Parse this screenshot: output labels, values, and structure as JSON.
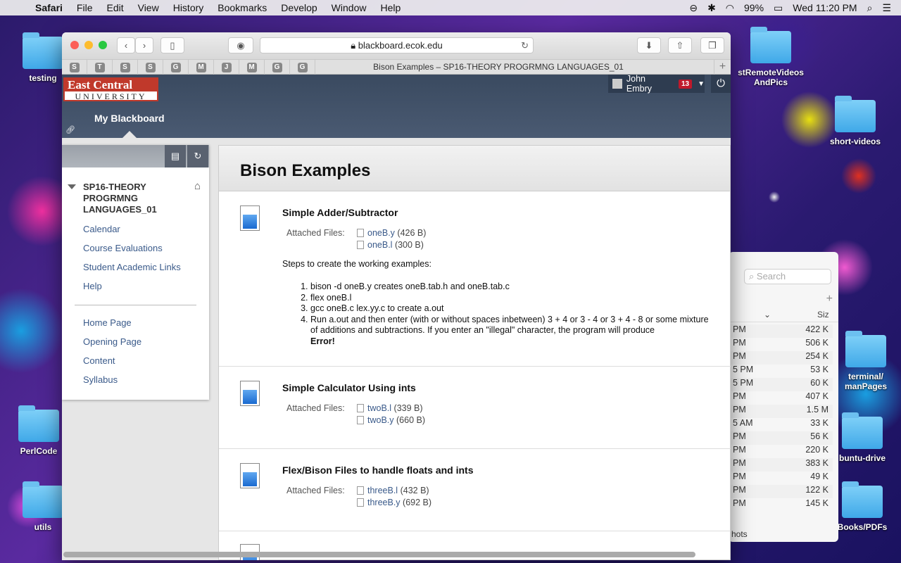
{
  "menubar": {
    "items": [
      "Safari",
      "File",
      "Edit",
      "View",
      "History",
      "Bookmarks",
      "Develop",
      "Window",
      "Help"
    ],
    "battery": "99%",
    "clock": "Wed 11:20 PM"
  },
  "desktop": {
    "icons": [
      "testing",
      "stRemoteVideos AndPics",
      "short-videos",
      "PerlCode",
      "utils",
      "terminal/ manPages",
      "buntu-drive",
      "Books/PDFs"
    ]
  },
  "finder": {
    "search_placeholder": "Search",
    "size_header": "Siz",
    "rows": [
      {
        "date": "PM",
        "size": "422 K"
      },
      {
        "date": "PM",
        "size": "506 K"
      },
      {
        "date": "PM",
        "size": "254 K"
      },
      {
        "date": "5 PM",
        "size": "53 K"
      },
      {
        "date": "5 PM",
        "size": "60 K"
      },
      {
        "date": "PM",
        "size": "407 K"
      },
      {
        "date": "PM",
        "size": "1.5 M"
      },
      {
        "date": "5 AM",
        "size": "33 K"
      },
      {
        "date": "PM",
        "size": "56 K"
      },
      {
        "date": "PM",
        "size": "220 K"
      },
      {
        "date": "PM",
        "size": "383 K"
      },
      {
        "date": "PM",
        "size": "49 K"
      },
      {
        "date": "PM",
        "size": "122 K"
      },
      {
        "date": "PM",
        "size": "145 K"
      }
    ],
    "footer": "hots"
  },
  "browser": {
    "url": "blackboard.ecok.edu",
    "favorites": [
      "S",
      "T",
      "S",
      "S",
      "G",
      "M",
      "J",
      "M",
      "G",
      "G"
    ],
    "tab_title": "Bison Examples – SP16-THEORY PROGRMNG LANGUAGES_01"
  },
  "bb": {
    "logo_line1": "East Central",
    "logo_line2": "UNIVERSITY",
    "user_name": "John Embry",
    "notifications": "13",
    "nav_tab": "My Blackboard"
  },
  "sidebar": {
    "course": "SP16-THEORY PROGRMNG LANGUAGES_01",
    "links1": [
      "Calendar",
      "Course Evaluations",
      "Student Academic Links",
      "Help"
    ],
    "links2": [
      "Home Page",
      "Opening Page",
      "Content",
      "Syllabus"
    ]
  },
  "main": {
    "heading": "Bison Examples",
    "attached_label": "Attached Files:",
    "items": [
      {
        "title": "Simple Adder/Subtractor",
        "files": [
          {
            "name": "oneB.y",
            "size": "(426 B)"
          },
          {
            "name": "oneB.l",
            "size": "(300 B)"
          }
        ],
        "steps_intro": "Steps to create the working examples:",
        "steps": [
          "bison -d oneB.y   creates oneB.tab.h and oneB.tab.c",
          "flex oneB.l",
          "gcc oneB.c lex.yy.c     to create a.out",
          "Run a.out and then enter (with or without spaces inbetween) 3 + 4 or 3 - 4 or 3 + 4 - 8 or some mixture of additions and subtractions. If you enter an \"illegal\" character, the program will produce"
        ],
        "step_error": "Error!"
      },
      {
        "title": "Simple Calculator Using ints",
        "files": [
          {
            "name": "twoB.l",
            "size": "(339 B)"
          },
          {
            "name": "twoB.y",
            "size": "(660 B)"
          }
        ]
      },
      {
        "title": "Flex/Bison Files to handle floats and ints",
        "files": [
          {
            "name": "threeB.l",
            "size": "(432 B)"
          },
          {
            "name": "threeB.y",
            "size": "(692 B)"
          }
        ]
      }
    ]
  }
}
